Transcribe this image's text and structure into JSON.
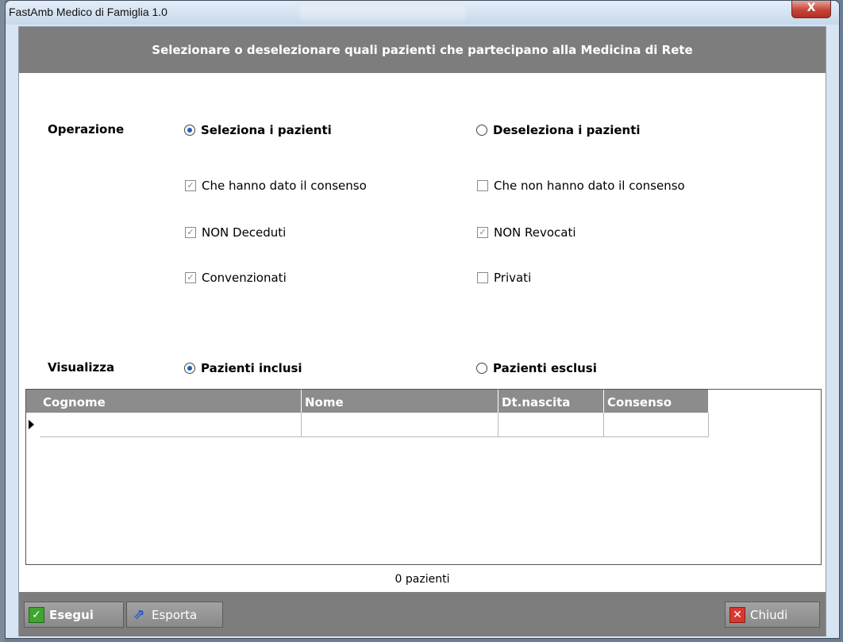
{
  "window": {
    "title": "FastAmb Medico di Famiglia 1.0",
    "close_glyph": "X"
  },
  "header": {
    "text": "Selezionare o deselezionare quali pazienti che partecipano alla Medicina di Rete"
  },
  "operazione": {
    "label": "Operazione",
    "radio_select": {
      "label": "Seleziona i pazienti",
      "checked": true
    },
    "radio_deselect": {
      "label": "Deseleziona i pazienti",
      "checked": false
    }
  },
  "filters_left": [
    {
      "label": "Che hanno dato il consenso",
      "checked": true
    },
    {
      "label": "NON Deceduti",
      "checked": true
    },
    {
      "label": "Convenzionati",
      "checked": true
    }
  ],
  "filters_right": [
    {
      "label": "Che non hanno dato il consenso",
      "checked": false
    },
    {
      "label": "NON Revocati",
      "checked": true
    },
    {
      "label": "Privati",
      "checked": false
    }
  ],
  "visualizza": {
    "label": "Visualizza",
    "radio_inclusi": {
      "label": "Pazienti inclusi",
      "checked": true
    },
    "radio_esclusi": {
      "label": "Pazienti esclusi",
      "checked": false
    }
  },
  "grid": {
    "columns": [
      "Cognome",
      "Nome",
      "Dt.nascita",
      "Consenso"
    ],
    "rows": [
      [
        "",
        "",
        "",
        ""
      ]
    ]
  },
  "status": {
    "count_text": "0 pazienti"
  },
  "footer": {
    "esegui_label": "Esegui",
    "esporta_label": "Esporta",
    "chiudi_label": "Chiudi"
  }
}
